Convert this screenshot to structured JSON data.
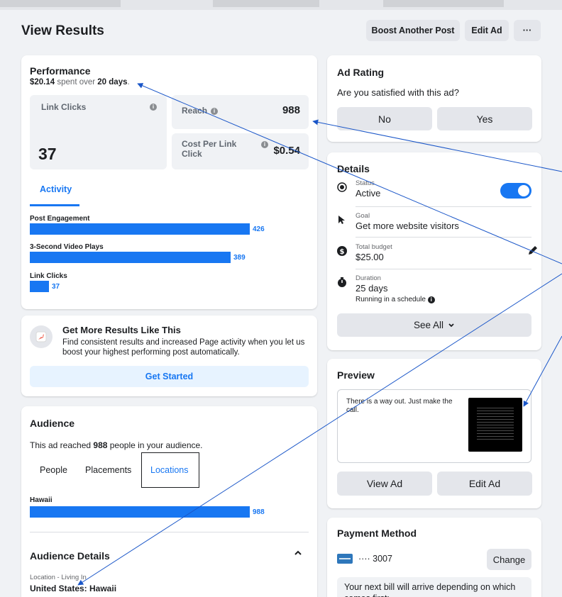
{
  "header": {
    "title": "View Results",
    "buttons": {
      "boost": "Boost Another Post",
      "edit": "Edit Ad",
      "more": "···"
    }
  },
  "performance": {
    "title": "Performance",
    "spent_amount": "$20.14",
    "spent_text": " spent over ",
    "days": "20 days",
    "days_suffix": ".",
    "link_clicks_label": "Link Clicks",
    "link_clicks_value": "37",
    "reach_label": "Reach",
    "reach_value": "988",
    "cpc_label": "Cost Per Link Click",
    "cpc_value": "$0.54",
    "activity_tab": "Activity",
    "bars": [
      {
        "label": "Post Engagement",
        "value": "426",
        "fraction": 1.0
      },
      {
        "label": "3-Second Video Plays",
        "value": "389",
        "fraction": 0.913
      },
      {
        "label": "Link Clicks",
        "value": "37",
        "fraction": 0.087
      }
    ]
  },
  "promo": {
    "title": "Get More Results Like This",
    "text": "Find consistent results and increased Page activity when you let us boost your highest performing post automatically.",
    "button": "Get Started"
  },
  "audience": {
    "title": "Audience",
    "reached_prefix": "This ad reached ",
    "reached_count": "988",
    "reached_suffix": " people in your audience.",
    "tabs": [
      "People",
      "Placements",
      "Locations"
    ],
    "bar": {
      "label": "Hawaii",
      "value": "988",
      "fraction": 1.0
    },
    "details_title": "Audience Details",
    "location_label": "Location - Living In",
    "location_value": "United States: Hawaii"
  },
  "rating": {
    "title": "Ad Rating",
    "question": "Are you satisfied with this ad?",
    "no": "No",
    "yes": "Yes"
  },
  "details": {
    "title": "Details",
    "status_label": "Status",
    "status_value": "Active",
    "goal_label": "Goal",
    "goal_value": "Get more website visitors",
    "budget_label": "Total budget",
    "budget_value": "$25.00",
    "duration_label": "Duration",
    "duration_value": "25 days",
    "duration_note": "Running in a schedule",
    "see_all": "See All",
    "toggle_on": true
  },
  "preview": {
    "title": "Preview",
    "post_text": "There is a way out. Just make the call.",
    "view_ad": "View Ad",
    "edit_ad": "Edit Ad"
  },
  "payment": {
    "title": "Payment Method",
    "card_masked": "···· 3007",
    "change": "Change",
    "bill_text": "Your next bill will arrive depending on which comes first:"
  },
  "colors": {
    "accent": "#1877f2",
    "annotation": "#1a56c8",
    "background": "#f0f2f5"
  }
}
